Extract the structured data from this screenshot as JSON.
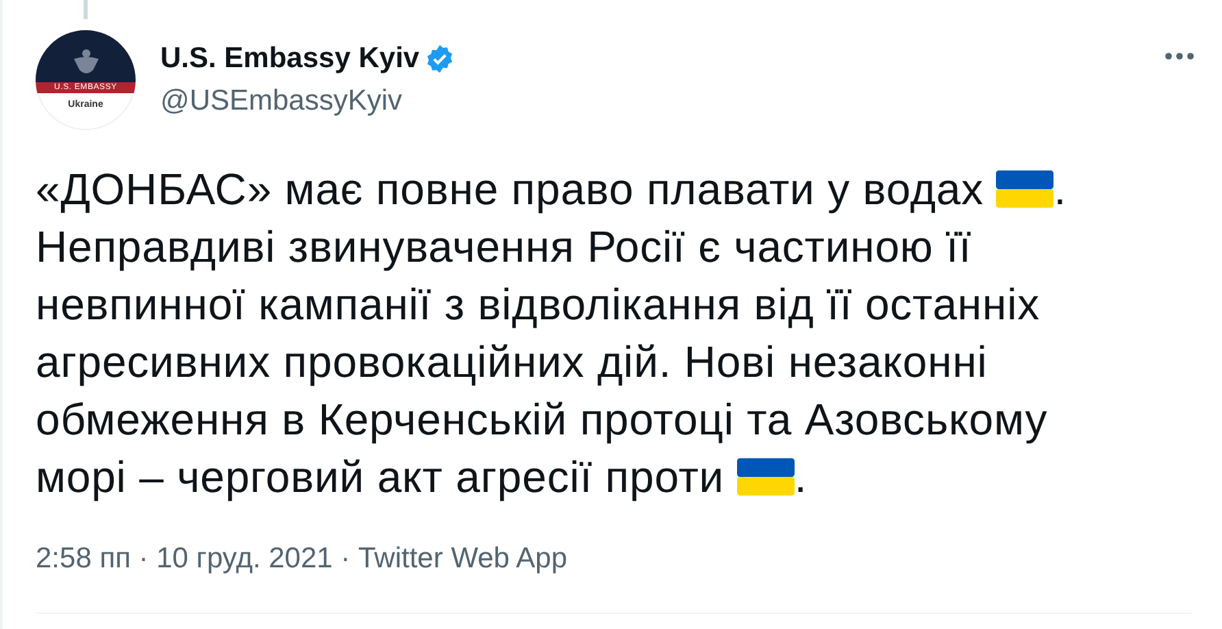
{
  "author": {
    "name": "U.S. Embassy Kyiv",
    "verified": true,
    "handle": "@USEmbassyKyiv",
    "avatar": {
      "banner": "U.S. EMBASSY",
      "caption": "Ukraine"
    }
  },
  "body": [
    [
      {
        "kind": "text",
        "text": "«ДОНБАС» має повне право плавати у водах "
      },
      {
        "kind": "flag"
      },
      {
        "kind": "text",
        "text": "."
      }
    ],
    [
      {
        "kind": "text",
        "text": "Неправдиві звинувачення Росії є частиною її"
      }
    ],
    [
      {
        "kind": "text",
        "text": "невпинної кампанії з відволікання від її останніх"
      }
    ],
    [
      {
        "kind": "text",
        "text": "агресивних провокаційних дій. Нові незаконні"
      }
    ],
    [
      {
        "kind": "text",
        "text": "обмеження в Керченській протоці та Азовському"
      }
    ],
    [
      {
        "kind": "text",
        "text": "морі – черговий акт агресії проти "
      },
      {
        "kind": "flag"
      },
      {
        "kind": "text",
        "text": "."
      }
    ]
  ],
  "meta": "2:58 пп · 10 груд. 2021 · Twitter Web App"
}
